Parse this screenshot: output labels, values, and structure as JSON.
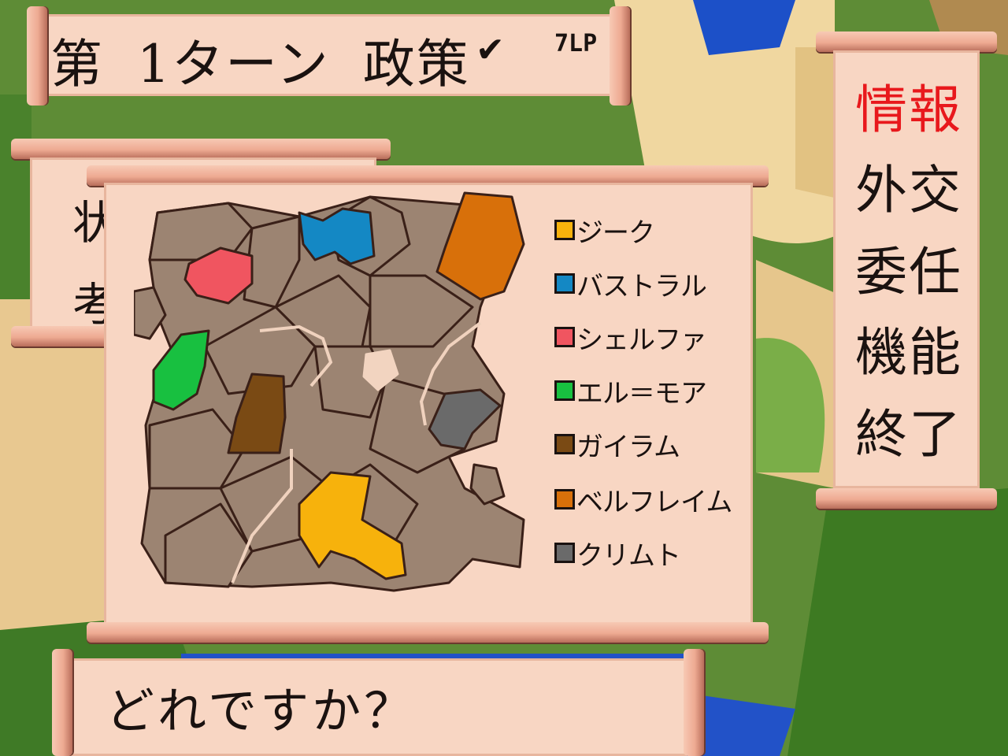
{
  "header": {
    "turn_title": "第",
    "turn_number": "1ターン",
    "phase": "政策",
    "status_mark": "✔",
    "lp_label": "7LP"
  },
  "back_panel": {
    "glyph_top": "状",
    "glyph_bottom": "考"
  },
  "menu": {
    "items": [
      {
        "label": "情報",
        "selected": true
      },
      {
        "label": "外交",
        "selected": false
      },
      {
        "label": "委任",
        "selected": false
      },
      {
        "label": "機能",
        "selected": false
      },
      {
        "label": "終了",
        "selected": false
      }
    ],
    "selected_color": "#e8181c"
  },
  "legend": {
    "factions": [
      {
        "name": "ジーク",
        "color": "#f7b20c"
      },
      {
        "name": "バストラル",
        "color": "#1488c4"
      },
      {
        "name": "シェルファ",
        "color": "#f05560"
      },
      {
        "name": "エル＝モア",
        "color": "#18c040"
      },
      {
        "name": "ガイラム",
        "color": "#7a4a14"
      },
      {
        "name": "ベルフレイム",
        "color": "#d8700a"
      },
      {
        "name": "クリムト",
        "color": "#6a6a6a"
      }
    ]
  },
  "map": {
    "neutral_color": "#9c8472",
    "border_color": "#3a2018"
  },
  "prompt": {
    "text": "どれですか？"
  }
}
